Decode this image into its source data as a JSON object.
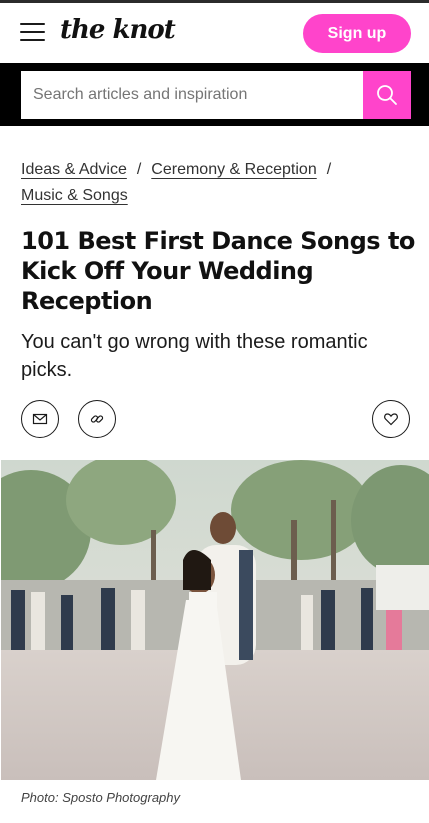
{
  "header": {
    "logo_text": "the knot",
    "signup_label": "Sign up",
    "menu_icon": "hamburger-icon"
  },
  "search": {
    "placeholder": "Search articles and inspiration",
    "icon": "search-icon"
  },
  "breadcrumb": {
    "items": [
      "Ideas & Advice",
      "Ceremony & Reception",
      "Music & Songs"
    ],
    "separator": "/"
  },
  "article": {
    "title": "101 Best First Dance Songs to Kick Off Your Wedding Reception",
    "subtitle": "You can't go wrong with these romantic picks.",
    "share_icons": [
      "email-icon",
      "link-icon"
    ],
    "save_icon": "heart-icon",
    "photo_credit": "Photo: Sposto Photography"
  },
  "colors": {
    "brand_pink": "#ff44cb",
    "search_bar_bg": "#000000",
    "text": "#1b1b1b"
  }
}
